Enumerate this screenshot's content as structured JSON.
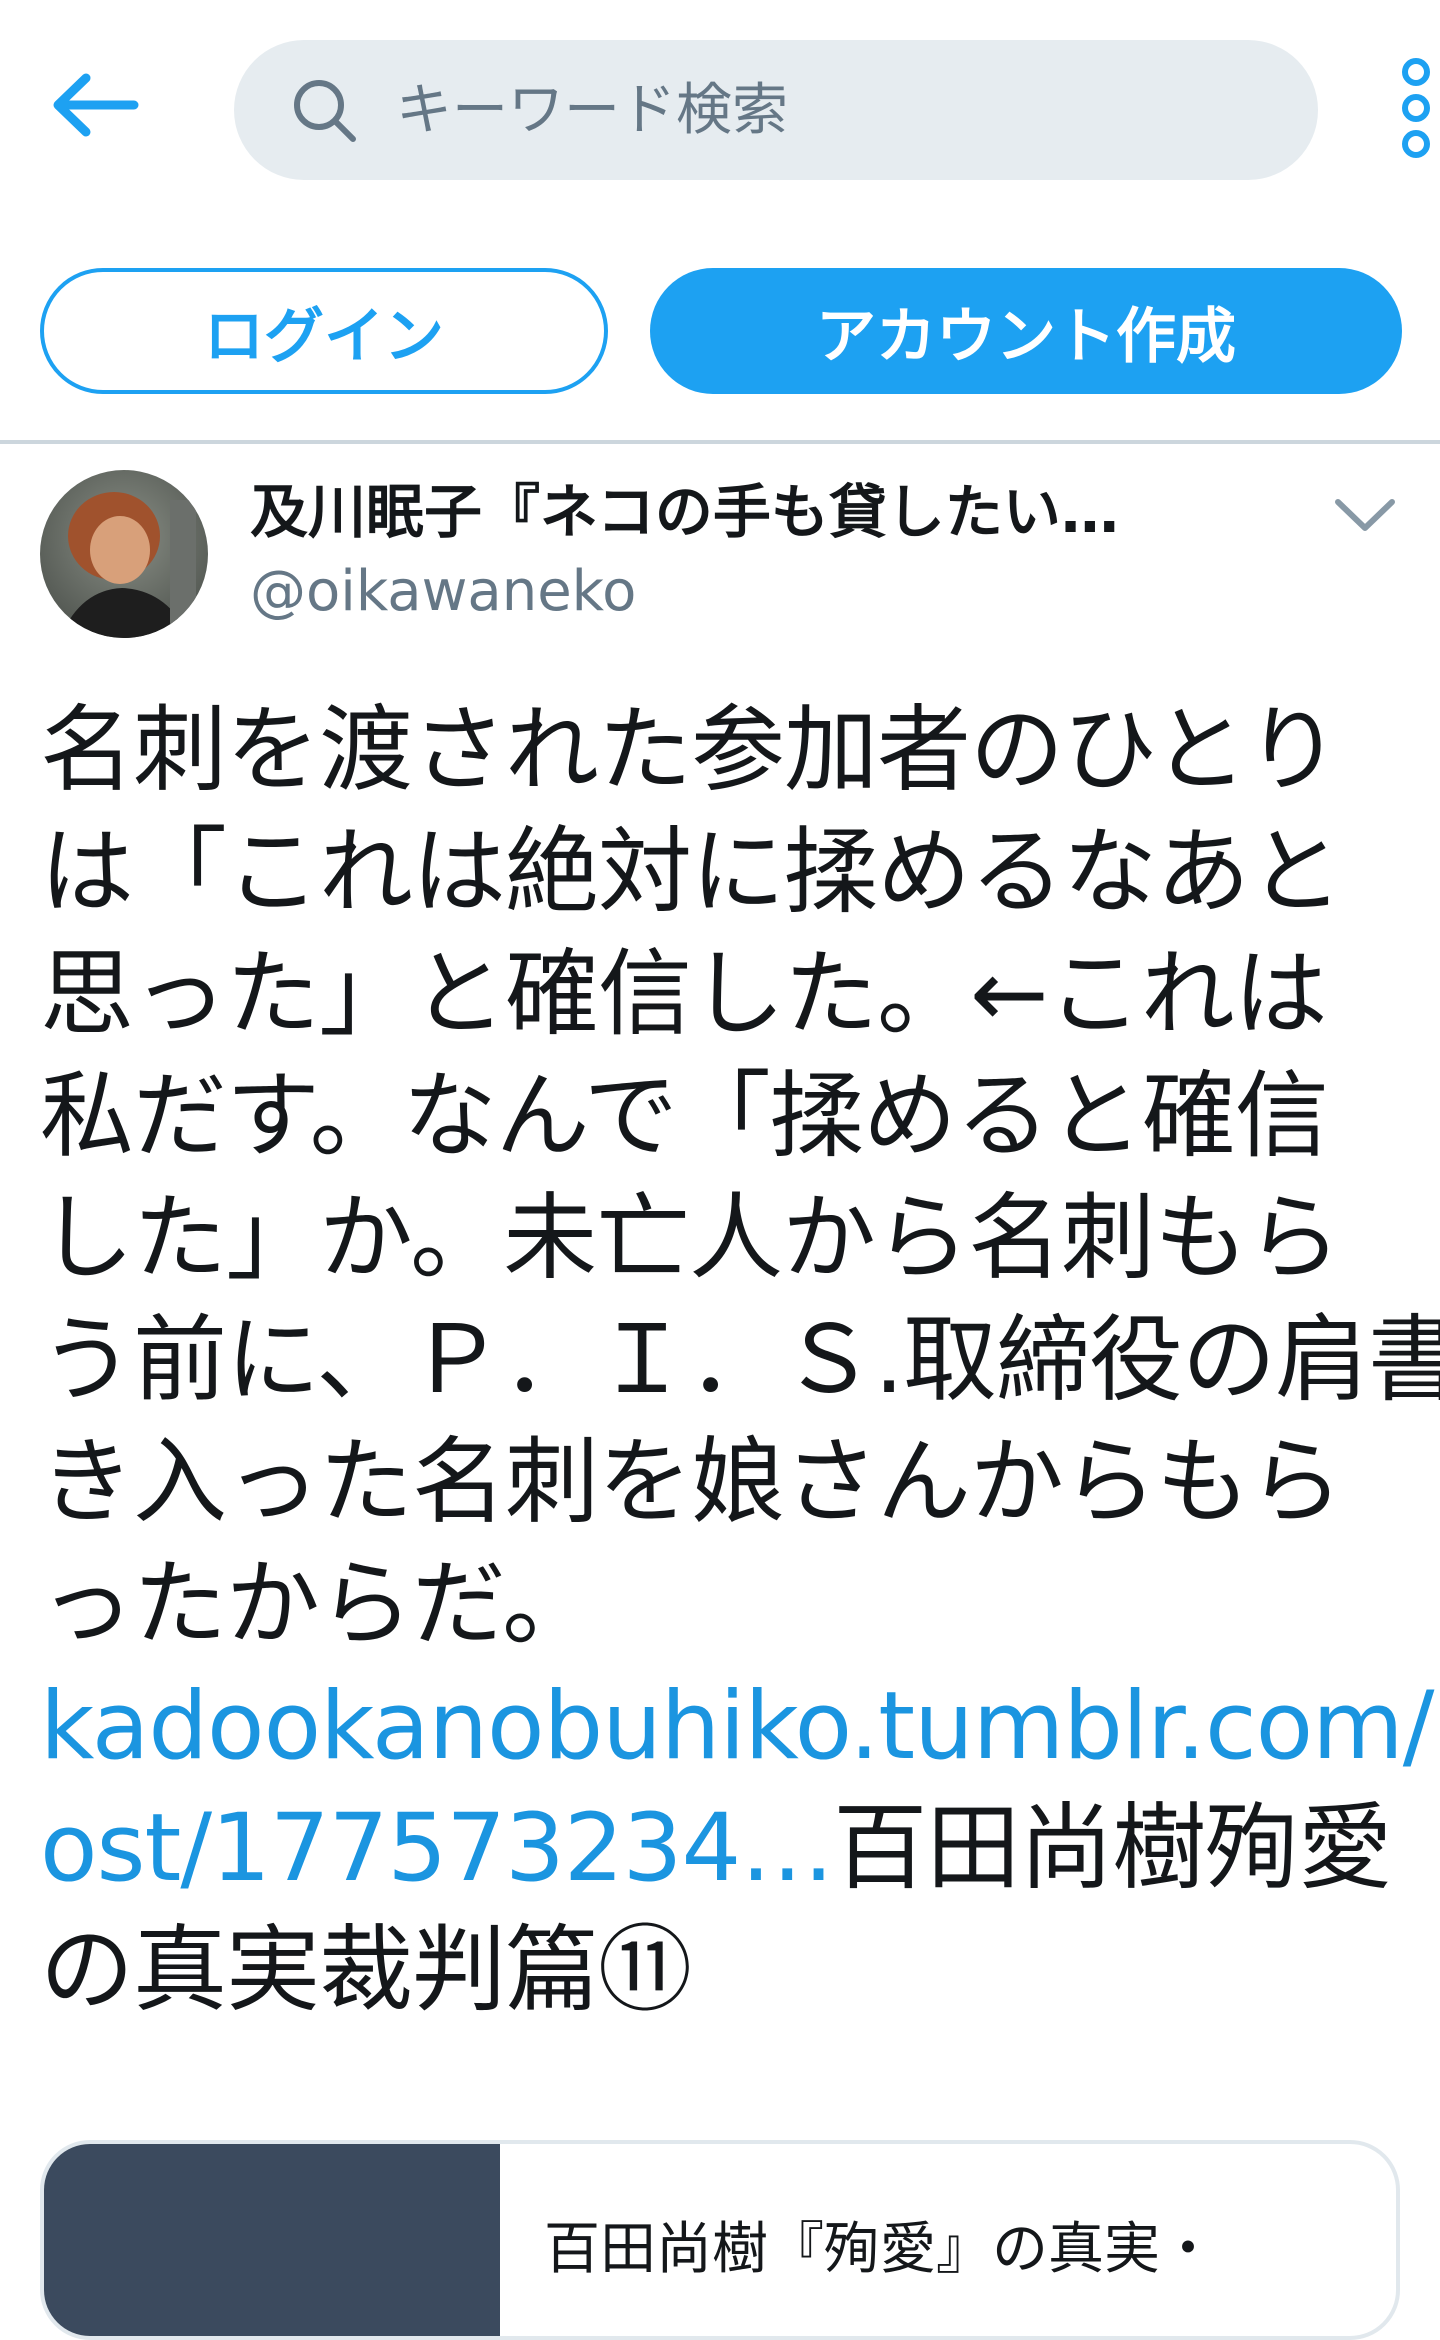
{
  "header": {
    "back_icon": "arrow-left-icon",
    "search": {
      "placeholder": "キーワード検索",
      "value": "",
      "icon": "search-icon"
    },
    "more_icon": "vertical-ellipsis-icon"
  },
  "auth": {
    "login_label": "ログイン",
    "signup_label": "アカウント作成"
  },
  "tweet": {
    "author": {
      "display_name": "及川眠子『ネコの手も貸したい…",
      "handle": "@oikawaneko"
    },
    "menu_icon": "chevron-down-icon",
    "body_lines": [
      "名刺を渡された参加者のひとり",
      "は「これは絶対に揉めるなあと",
      "思った」と確信した。←これは",
      "私だす。なんで「揉めると確信",
      "した」か。未亡人から名刺もら",
      "う前に、Ｐ．Ｉ．Ｓ.取締役の肩書",
      "き入った名刺を娘さんからもら",
      "ったからだ。"
    ],
    "link_line1": "kadookanobuhiko.tumblr.com/p",
    "link_line2": "ost/177573234…",
    "after_link": "百田尚樹殉愛",
    "last_line": "の真実裁判篇⑪"
  },
  "card": {
    "title": "百田尚樹『殉愛』の真実・"
  },
  "colors": {
    "brand": "#1da1f2",
    "link": "#1b95e0",
    "search_bg": "#e6ecf0",
    "muted": "#657786"
  }
}
